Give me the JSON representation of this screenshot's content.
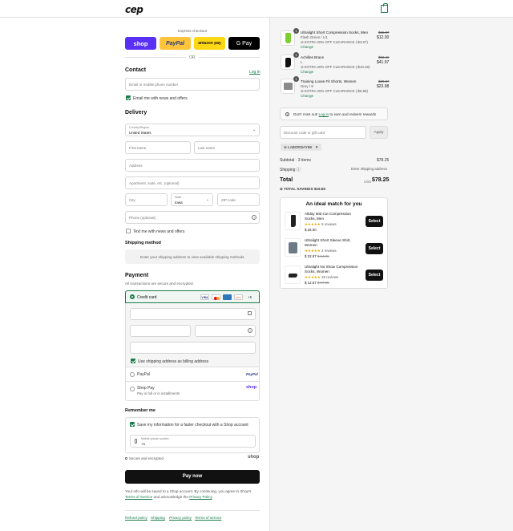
{
  "header": {
    "logo": "cep",
    "cart_icon": "shopping-bag-icon"
  },
  "express": {
    "label": "Express checkout",
    "shop": "shop",
    "paypal": "PayPal",
    "amazon": "amazon pay",
    "gpay": "G Pay",
    "or": "OR"
  },
  "contact": {
    "title": "Contact",
    "login": "Log in",
    "email_placeholder": "Email or mobile phone number",
    "news_label": "Email me with news and offers"
  },
  "delivery": {
    "title": "Delivery",
    "country_label": "Country/Region",
    "country_value": "United States",
    "first_name": "First name",
    "last_name": "Last name",
    "address": "Address",
    "apartment": "Apartment, suite, etc. (optional)",
    "city": "City",
    "state_label": "State",
    "state_value": "Iowa",
    "zip": "ZIP code",
    "phone": "Phone (optional)",
    "text_label": "Text me with news and offers"
  },
  "shipping": {
    "title": "Shipping method",
    "message": "Enter your shipping address to view available shipping methods."
  },
  "payment": {
    "title": "Payment",
    "subtitle": "All transactions are secure and encrypted.",
    "credit_card": "Credit card",
    "more_cards": "+5",
    "billing_label": "Use shipping address as billing address",
    "paypal": "PayPal",
    "paypal_logo": "PayPal",
    "shoppay": "Shop Pay",
    "shoppay_sub": "Pay in full or in installments",
    "shoppay_logo": "shop"
  },
  "remember": {
    "title": "Remember me",
    "save_label": "Save my information for a faster checkout with a Shop account",
    "phone_label": "Mobile phone number",
    "phone_value": "+1",
    "secure": "Secure and encrypted",
    "shop_logo": "shop"
  },
  "pay_now": "Pay now",
  "legal": {
    "text1": "Your info will be saved to a Shop account. By continuing, you agree to Shop's",
    "terms": "Terms of Service",
    "text2": "and acknowledge the",
    "privacy": "Privacy Policy",
    "period": "."
  },
  "footer_links": [
    "Refund policy",
    "Shipping",
    "Privacy policy",
    "Terms of service"
  ],
  "cart": {
    "items": [
      {
        "qty": "1",
        "name": "Ultralight Short Compression Socks, Men",
        "variant": "Flash Green / L/1",
        "discount": "EXTRA 20% OFF CLEARANCE (-$3.07)",
        "change": "Change",
        "old_price": "$15.37",
        "price": "$12.30"
      },
      {
        "qty": "1",
        "name": "Achilles Brace",
        "variant": "L",
        "discount": "EXTRA 20% OFF CLEARANCE (-$10.49)",
        "change": "Change",
        "old_price": "$52.46",
        "price": "$41.97"
      },
      {
        "qty": "1",
        "name": "Training Loose Fit Shorts, Women",
        "variant": "Grey / S",
        "discount": "EXTRA 20% OFF CLEARANCE (-$5.99)",
        "change": "Change",
        "old_price": "$29.97",
        "price": "$23.98"
      }
    ],
    "login_note": "Don't miss out!",
    "login_link": "Log in",
    "login_note2": "to earn and redeem rewards",
    "discount_placeholder": "Discount code or gift card",
    "apply": "Apply",
    "applied_code": "LABORDAY69",
    "subtotal_label": "Subtotal · 3 items",
    "subtotal": "$78.25",
    "shipping_label": "Shipping",
    "shipping_value": "Enter shipping address",
    "total_label": "Total",
    "currency": "USD",
    "total": "$78.25",
    "savings_label": "TOTAL SAVINGS",
    "savings": "$19.55"
  },
  "recommend": {
    "title": "An ideal match for you",
    "select": "Select",
    "items": [
      {
        "name": "Allday Mid Cut Compression Socks, Men",
        "stars": "★★★★★",
        "reviews": "5 reviews",
        "price": "$ 26.00",
        "old": ""
      },
      {
        "name": "Ultralight Short Sleeve Shirt, Women",
        "stars": "★★★★★",
        "reviews": "4 reviews",
        "price": "$ 32.97",
        "old": "$ 54.95"
      },
      {
        "name": "Ultralight No Show Compression Socks, Women",
        "stars": "★★★★★",
        "reviews": "33 reviews",
        "price": "$ 12.57",
        "old": "$ 17.95"
      }
    ]
  },
  "colors": {
    "accent": "#1a7b49",
    "shop": "#5a31f4",
    "paypal": "#ffc439",
    "amazon": "#ffd814",
    "black": "#111111"
  }
}
